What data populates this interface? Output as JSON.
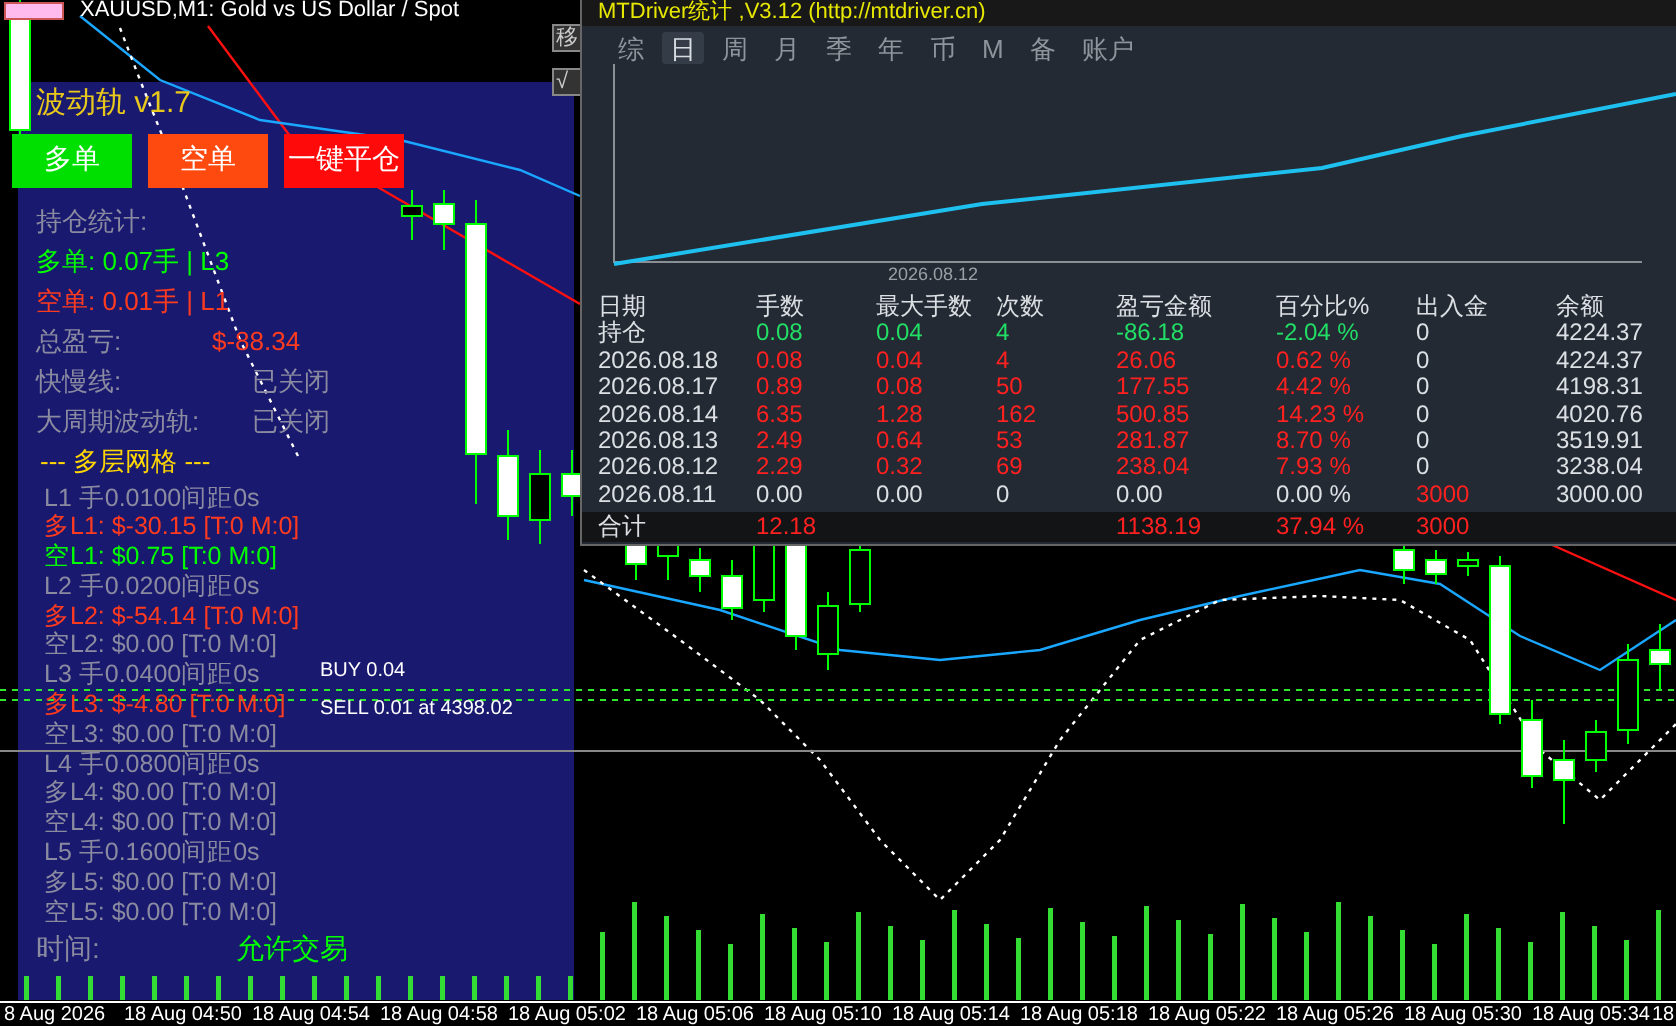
{
  "chart_window": {
    "title": "XAUUSD,M1: Gold vs US Dollar / Spot",
    "side_buttons": [
      "移",
      "√"
    ]
  },
  "ea_panel": {
    "title": "波动轨 v1.7",
    "buttons": [
      {
        "label": "多单",
        "kind": "buy"
      },
      {
        "label": "空单",
        "kind": "sell"
      },
      {
        "label": "一键平仓",
        "kind": "close"
      }
    ],
    "stats": [
      {
        "label": "持仓统计:",
        "color": "#8a8aa0"
      },
      {
        "label": "多单: 0.07手 | L3",
        "color": "#00ff00"
      },
      {
        "label": "空单: 0.01手 | L1",
        "color": "#ff3b1f"
      },
      {
        "label": "总盈亏:",
        "color": "#8a8aa0",
        "value": {
          "text": "$-88.34",
          "color": "#ff3b1f"
        }
      },
      {
        "label": "快慢线:",
        "color": "#8a8aa0",
        "value": {
          "text": "已关闭",
          "color": "#8a8aa0"
        }
      },
      {
        "label": "大周期波动轨:",
        "color": "#8a8aa0",
        "value": {
          "text": "已关闭",
          "color": "#8a8aa0"
        }
      }
    ],
    "grid": {
      "title": "--- 多层网格 ---",
      "lines": [
        {
          "text": "L1 手0.0100间距0s",
          "color": "#8a8aa0"
        },
        {
          "text": "多L1: $-30.15 [T:0 M:0]",
          "color": "#ff3b1f"
        },
        {
          "text": "空L1: $0.75 [T:0 M:0]",
          "color": "#00ff00"
        },
        {
          "text": "L2 手0.0200间距0s",
          "color": "#8a8aa0"
        },
        {
          "text": "多L2: $-54.14 [T:0 M:0]",
          "color": "#ff3b1f"
        },
        {
          "text": "空L2: $0.00 [T:0 M:0]",
          "color": "#8a8aa0"
        },
        {
          "text": "L3 手0.0400间距0s",
          "color": "#8a8aa0"
        },
        {
          "text": "多L3: $-4.80 [T:0 M:0]",
          "color": "#ff3b1f"
        },
        {
          "text": "空L3: $0.00 [T:0 M:0]",
          "color": "#8a8aa0"
        },
        {
          "text": "L4 手0.0800间距0s",
          "color": "#8a8aa0"
        },
        {
          "text": "多L4: $0.00 [T:0 M:0]",
          "color": "#8a8aa0"
        },
        {
          "text": "空L4: $0.00 [T:0 M:0]",
          "color": "#8a8aa0"
        },
        {
          "text": "L5 手0.1600间距0s",
          "color": "#8a8aa0"
        },
        {
          "text": "多L5: $0.00 [T:0 M:0]",
          "color": "#8a8aa0"
        },
        {
          "text": "空L5: $0.00 [T:0 M:0]",
          "color": "#8a8aa0"
        }
      ]
    },
    "footer": {
      "label": "时间:",
      "status": "允许交易"
    }
  },
  "trade_labels": [
    "BUY 0.04",
    "SELL 0.01 at 4398.02"
  ],
  "stats_window": {
    "title": "MTDriver统计 ,V3.12 (http://mtdriver.cn)",
    "tabs": [
      {
        "label": "综",
        "selected": false
      },
      {
        "label": "日",
        "selected": true
      },
      {
        "label": "周",
        "selected": false
      },
      {
        "label": "月",
        "selected": false
      },
      {
        "label": "季",
        "selected": false
      },
      {
        "label": "年",
        "selected": false
      },
      {
        "label": "币",
        "selected": false
      },
      {
        "label": "M",
        "selected": false
      },
      {
        "label": "备",
        "selected": false
      },
      {
        "label": "账户",
        "selected": false
      }
    ],
    "equity_chart": {
      "x_label": "2026.08.12"
    },
    "table": {
      "columns": [
        "日期",
        "手数",
        "最大手数",
        "次数",
        "盈亏金额",
        "百分比%",
        "出入金",
        "余额"
      ],
      "rows": [
        {
          "cells": [
            {
              "text": "持仓"
            },
            {
              "text": "0.08",
              "color": "#22dd66"
            },
            {
              "text": "0.04",
              "color": "#22dd66"
            },
            {
              "text": "4",
              "color": "#22dd66"
            },
            {
              "text": "-86.18",
              "color": "#22dd66"
            },
            {
              "text": "-2.04 %",
              "color": "#22dd66"
            },
            {
              "text": "0"
            },
            {
              "text": "4224.37"
            }
          ]
        },
        {
          "cells": [
            {
              "text": "2026.08.18"
            },
            {
              "text": "0.08",
              "color": "#ff2020"
            },
            {
              "text": "0.04",
              "color": "#ff2020"
            },
            {
              "text": "4",
              "color": "#ff2020"
            },
            {
              "text": "26.06",
              "color": "#ff2020"
            },
            {
              "text": "0.62 %",
              "color": "#ff2020"
            },
            {
              "text": "0"
            },
            {
              "text": "4224.37"
            }
          ]
        },
        {
          "cells": [
            {
              "text": "2026.08.17"
            },
            {
              "text": "0.89",
              "color": "#ff2020"
            },
            {
              "text": "0.08",
              "color": "#ff2020"
            },
            {
              "text": "50",
              "color": "#ff2020"
            },
            {
              "text": "177.55",
              "color": "#ff2020"
            },
            {
              "text": "4.42 %",
              "color": "#ff2020"
            },
            {
              "text": "0"
            },
            {
              "text": "4198.31"
            }
          ]
        },
        {
          "cells": [
            {
              "text": "2026.08.14"
            },
            {
              "text": "6.35",
              "color": "#ff2020"
            },
            {
              "text": "1.28",
              "color": "#ff2020"
            },
            {
              "text": "162",
              "color": "#ff2020"
            },
            {
              "text": "500.85",
              "color": "#ff2020"
            },
            {
              "text": "14.23 %",
              "color": "#ff2020"
            },
            {
              "text": "0"
            },
            {
              "text": "4020.76"
            }
          ]
        },
        {
          "cells": [
            {
              "text": "2026.08.13"
            },
            {
              "text": "2.49",
              "color": "#ff2020"
            },
            {
              "text": "0.64",
              "color": "#ff2020"
            },
            {
              "text": "53",
              "color": "#ff2020"
            },
            {
              "text": "281.87",
              "color": "#ff2020"
            },
            {
              "text": "8.70 %",
              "color": "#ff2020"
            },
            {
              "text": "0"
            },
            {
              "text": "3519.91"
            }
          ]
        },
        {
          "cells": [
            {
              "text": "2026.08.12"
            },
            {
              "text": "2.29",
              "color": "#ff2020"
            },
            {
              "text": "0.32",
              "color": "#ff2020"
            },
            {
              "text": "69",
              "color": "#ff2020"
            },
            {
              "text": "238.04",
              "color": "#ff2020"
            },
            {
              "text": "7.93 %",
              "color": "#ff2020"
            },
            {
              "text": "0"
            },
            {
              "text": "3238.04"
            }
          ]
        },
        {
          "cells": [
            {
              "text": "2026.08.11"
            },
            {
              "text": "0.00"
            },
            {
              "text": "0.00"
            },
            {
              "text": "0"
            },
            {
              "text": "0.00"
            },
            {
              "text": "0.00 %"
            },
            {
              "text": "3000",
              "color": "#ff2020"
            },
            {
              "text": "3000.00"
            }
          ]
        }
      ],
      "total": {
        "cells": [
          {
            "text": "合计"
          },
          {
            "text": "12.18",
            "color": "#ff2020"
          },
          null,
          null,
          {
            "text": "1138.19",
            "color": "#ff2020"
          },
          {
            "text": "37.94 %",
            "color": "#ff2020"
          },
          {
            "text": "3000",
            "color": "#ff2020"
          },
          null
        ]
      }
    }
  },
  "time_axis": [
    "8 Aug 2026",
    "18 Aug 04:50",
    "18 Aug 04:54",
    "18 Aug 04:58",
    "18 Aug 05:02",
    "18 Aug 05:06",
    "18 Aug 05:10",
    "18 Aug 05:14",
    "18 Aug 05:18",
    "18 Aug 05:22",
    "18 Aug 05:26",
    "18 Aug 05:30",
    "18 Aug 05:34",
    "18"
  ]
}
